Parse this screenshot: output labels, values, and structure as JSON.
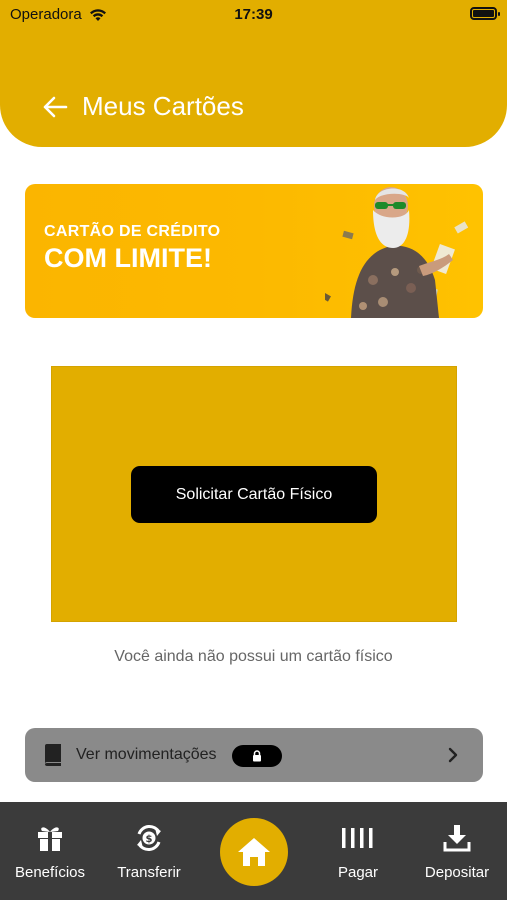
{
  "status_bar": {
    "carrier": "Operadora",
    "time": "17:39"
  },
  "header": {
    "title": "Meus Cartões"
  },
  "banner": {
    "line1": "CARTÃO DE CRÉDITO",
    "line2": "COM LIMITE!"
  },
  "card": {
    "request_button": "Solicitar Cartão Físico",
    "empty_message": "Você ainda não possui um cartão físico"
  },
  "movements": {
    "label": "Ver movimentações"
  },
  "tabbar": {
    "tabs": [
      {
        "label": "Benefícios",
        "icon": "gift-icon"
      },
      {
        "label": "Transferir",
        "icon": "transfer-money-icon"
      },
      {
        "label": "",
        "icon": "home-icon"
      },
      {
        "label": "Pagar",
        "icon": "barcode-icon"
      },
      {
        "label": "Depositar",
        "icon": "download-tray-icon"
      }
    ]
  },
  "colors": {
    "primary": "#e2ae00",
    "banner": "#fcb900",
    "tabbar": "#3b3b3b",
    "movements": "#8a8a8a"
  }
}
